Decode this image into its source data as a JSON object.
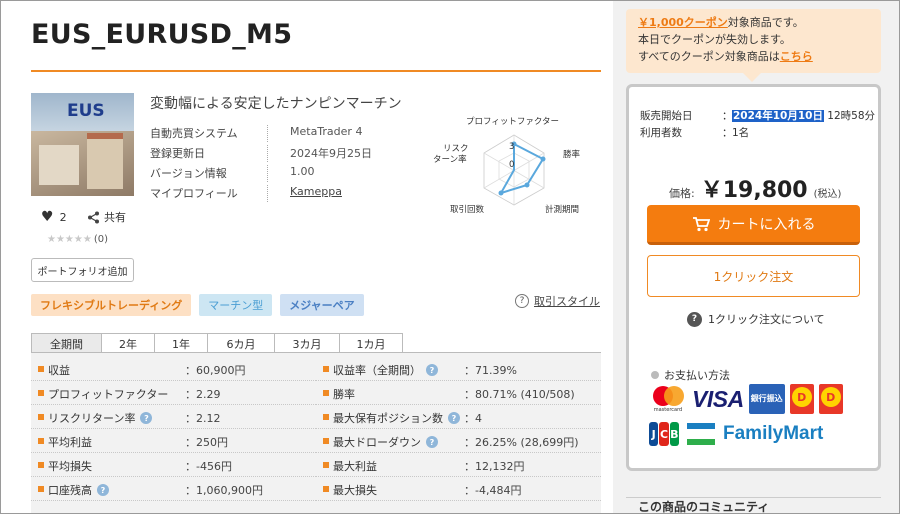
{
  "product": {
    "title": "EUS_EURUSD_M5",
    "subtitle": "変動幅による安定したナンピンマーチン",
    "thumbnail_text": "EUS",
    "likes": "2",
    "share_label": "共有",
    "stars": "★★★★★",
    "review_count": "(0)",
    "portfolio_button": "ポートフォリオ追加"
  },
  "info": [
    {
      "key": "自動売買システム",
      "value": "MetaTrader 4"
    },
    {
      "key": "登録更新日",
      "value": "2024年9月25日"
    },
    {
      "key": "バージョン情報",
      "value": "1.00"
    },
    {
      "key": "マイプロフィール",
      "value": "Kameppa"
    }
  ],
  "radar": {
    "labels": [
      "プロフィットファクター",
      "勝率",
      "計測期間",
      "取引回数",
      "リスク",
      "ターン率"
    ],
    "tick_top": "3",
    "tick_center": "0",
    "accent": "#5aa8dd"
  },
  "tags": [
    "フレキシブルトレーディング",
    "マーチン型",
    "メジャーペア"
  ],
  "trade_style": {
    "icon": "question-icon",
    "label": "取引スタイル"
  },
  "tabs": [
    "全期間",
    "2年",
    "1年",
    "6カ月",
    "3カ月",
    "1カ月"
  ],
  "stats_left": [
    {
      "label": "収益",
      "value": "：60,900円",
      "help": false
    },
    {
      "label": "プロフィットファクター",
      "value": "：2.29",
      "help": false
    },
    {
      "label": "リスクリターン率",
      "value": "：2.12",
      "help": true
    },
    {
      "label": "平均利益",
      "value": "：250円",
      "help": false
    },
    {
      "label": "平均損失",
      "value": "：-456円",
      "help": false
    },
    {
      "label": "口座残高",
      "value": "：1,060,900円",
      "help": true
    }
  ],
  "stats_right": [
    {
      "label": "収益率（全期間）",
      "value": "：71.39%",
      "help": true
    },
    {
      "label": "勝率",
      "value": "：80.71% (410/508)",
      "help": false
    },
    {
      "label": "最大保有ポジション数",
      "value": "：4",
      "help": true
    },
    {
      "label": "最大ドローダウン",
      "value": "：26.25% (28,699円)",
      "help": true
    },
    {
      "label": "最大利益",
      "value": "：12,132円",
      "help": false
    },
    {
      "label": "最大損失",
      "value": "：-4,484円",
      "help": false
    }
  ],
  "coupon": {
    "highlight": "￥1,000クーポン",
    "line1_rest": "対象商品です。",
    "line2": "本日でクーポンが失効します。",
    "line3_pre": "すべてのクーポン対象商品は",
    "line3_link": "こちら"
  },
  "sale": {
    "start_label": "販売開始日",
    "colon": "：",
    "start_date_selected": "2024年10月10日",
    "start_time": "12時58分",
    "users_label": "利用者数",
    "users_value": "1名"
  },
  "price": {
    "label": "価格:",
    "value": "￥19,800",
    "tax": "(税込)"
  },
  "cart_button": "カートに入れる",
  "oneclick_button": "1クリック注文",
  "oneclick_info": "1クリック注文について",
  "payment": {
    "title": "お支払い方法",
    "mastercard_text": "mastercard",
    "visa_text": "VISA",
    "bank_text": "銀行振込",
    "jcb_letters": [
      "J",
      "C",
      "B"
    ],
    "familymart_text": "FamilyMart"
  },
  "community_title": "この商品のコミュニティ",
  "colors": {
    "accent": "#f08a24",
    "cart": "#f47c0f",
    "selection": "#1e62c8",
    "coupon_bg": "#fde7cf"
  }
}
